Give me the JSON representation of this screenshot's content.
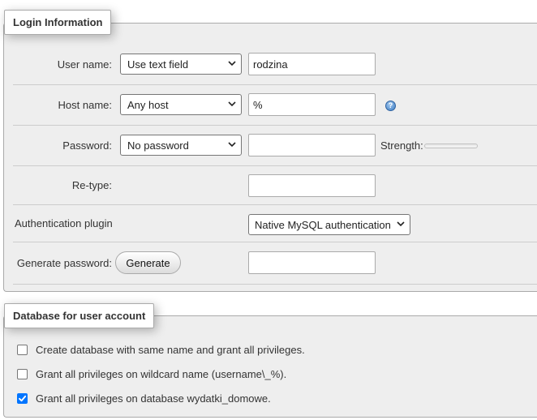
{
  "login_section": {
    "legend": "Login Information",
    "username": {
      "label": "User name:",
      "select_value": "Use text field",
      "input_value": "rodzina"
    },
    "hostname": {
      "label": "Host name:",
      "select_value": "Any host",
      "input_value": "%"
    },
    "password": {
      "label": "Password:",
      "select_value": "No password",
      "input_value": "",
      "strength_label": "Strength:"
    },
    "retype": {
      "label": "Re-type:",
      "input_value": ""
    },
    "auth_plugin": {
      "label": "Authentication plugin",
      "select_value": "Native MySQL authentication"
    },
    "generate_password": {
      "label": "Generate password:",
      "button_label": "Generate",
      "input_value": ""
    }
  },
  "database_section": {
    "legend": "Database for user account",
    "options": [
      {
        "label": "Create database with same name and grant all privileges.",
        "checked": false
      },
      {
        "label": "Grant all privileges on wildcard name (username\\_%).",
        "checked": false
      },
      {
        "label": "Grant all privileges on database wydatki_domowe.",
        "checked": true
      }
    ]
  },
  "colors": {
    "accent_checkbox": "#0075ff",
    "panel_bg": "#eeeeee",
    "row_border": "#cccccc"
  },
  "icons": {
    "help": "help-icon",
    "chevron": "chevron-down-icon",
    "check": "check-icon"
  }
}
